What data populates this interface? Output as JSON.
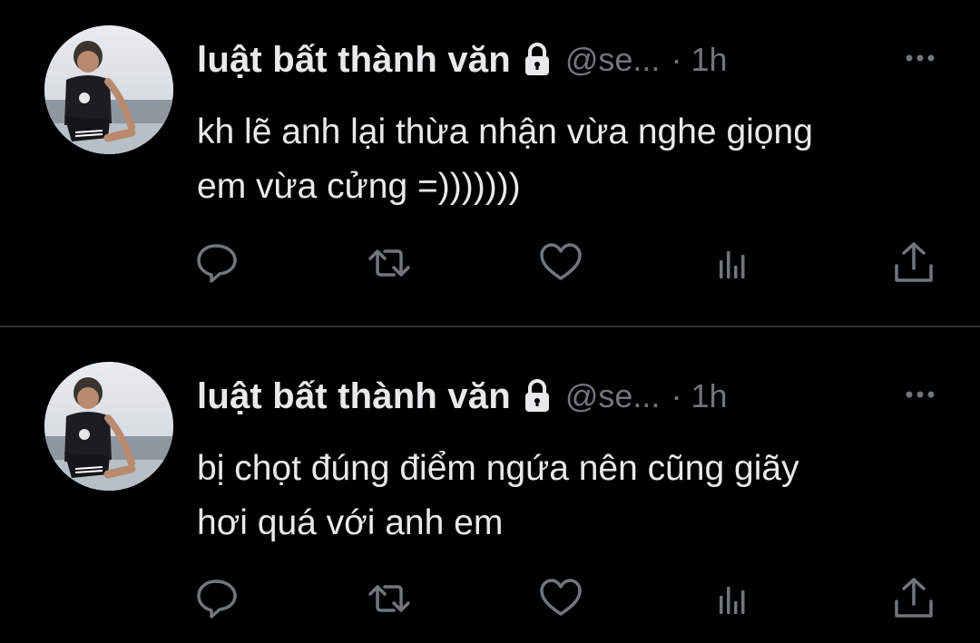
{
  "colors": {
    "background": "#000000",
    "primary_text": "#e7e9ea",
    "secondary_text": "#71767b",
    "divider": "#2f3336"
  },
  "tweets": [
    {
      "display_name": "luật bất thành văn",
      "handle": "@se...",
      "separator": "·",
      "time": "1h",
      "text_line1": "kh lẽ anh lại thừa nhận vừa nghe giọng",
      "text_line2": "em vừa cửng =)))))))",
      "icons": [
        "lock-icon",
        "more-icon",
        "reply-icon",
        "retweet-icon",
        "like-icon",
        "views-icon",
        "share-icon"
      ]
    },
    {
      "display_name": "luật bất thành văn",
      "handle": "@se...",
      "separator": "·",
      "time": "1h",
      "text_line1": "bị chọt đúng điểm ngứa nên cũng giãy",
      "text_line2": "hơi quá với anh em",
      "icons": [
        "lock-icon",
        "more-icon",
        "reply-icon",
        "retweet-icon",
        "like-icon",
        "views-icon",
        "share-icon"
      ]
    }
  ]
}
